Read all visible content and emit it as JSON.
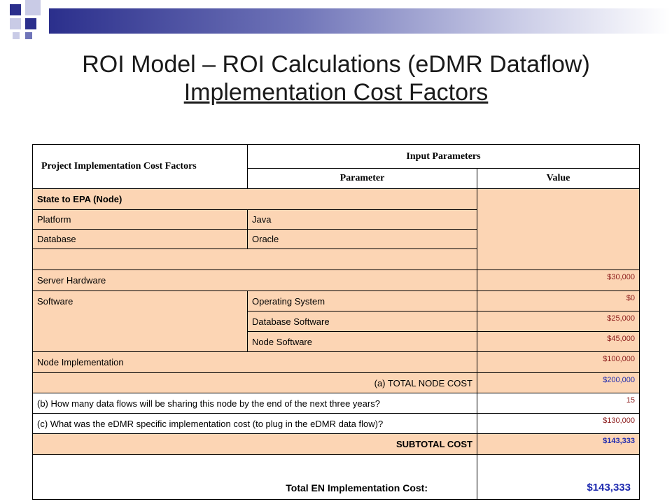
{
  "title": {
    "line1": "ROI Model – ROI Calculations (eDMR Dataflow)",
    "line2": "Implementation  Cost Factors"
  },
  "colors": {
    "navy": "#2b2f8c",
    "accent": "#6f74b8",
    "peach": "#fcd5b4",
    "value_red": "#8b1a1a",
    "value_blue": "#1f2bb0"
  },
  "table": {
    "header": {
      "factors": "Project Implementation Cost Factors",
      "input_parameters": "Input Parameters",
      "parameter": "Parameter",
      "value": "Value"
    },
    "section": "State to EPA (Node)",
    "platform": {
      "label": "Platform",
      "value": "Java"
    },
    "database": {
      "label": "Database",
      "value": "Oracle"
    },
    "server_hardware": {
      "label": "Server Hardware",
      "value": "$30,000"
    },
    "software": {
      "label": "Software",
      "items": [
        {
          "label": "Operating System",
          "value": "$0"
        },
        {
          "label": "Database Software",
          "value": "$25,000"
        },
        {
          "label": "Node Software",
          "value": "$45,000"
        }
      ]
    },
    "node_implementation": {
      "label": "Node Implementation",
      "value": "$100,000"
    },
    "total_node_cost": {
      "label": "(a) TOTAL NODE COST",
      "value": "$200,000"
    },
    "data_flows": {
      "label": "(b) How many data flows will be sharing this node by the end of the next three years?",
      "value": "15"
    },
    "edmr_cost": {
      "label": "(c) What was the eDMR specific implementation cost (to plug in the eDMR data flow)?",
      "value": "$130,000"
    },
    "subtotal": {
      "label": "SUBTOTAL COST",
      "value": "$143,333"
    },
    "grand_total": {
      "label": "Total EN Implementation Cost:",
      "value": "$143,333"
    }
  }
}
